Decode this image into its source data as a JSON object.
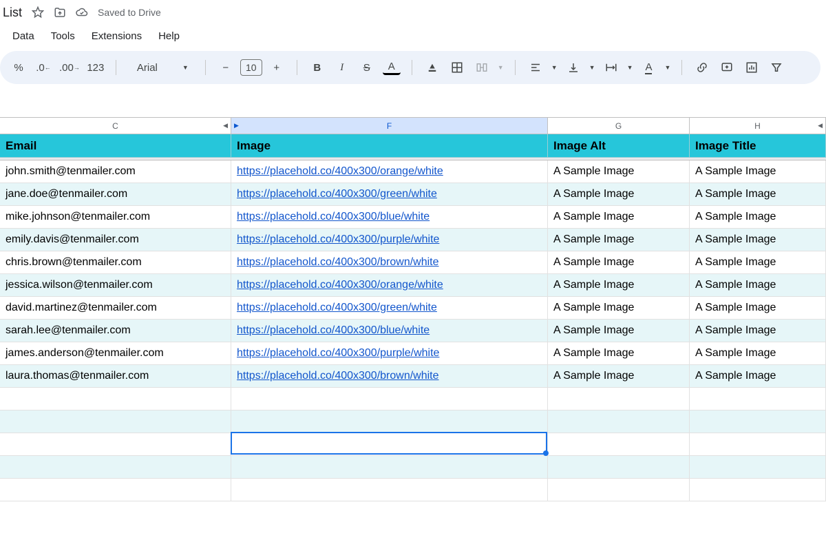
{
  "title": "List",
  "saved": "Saved to Drive",
  "menu": {
    "data": "Data",
    "tools": "Tools",
    "extensions": "Extensions",
    "help": "Help"
  },
  "toolbar": {
    "pct": "%",
    "dec_dec": ".0",
    "dec_inc": ".00",
    "fmt123": "123",
    "font": "Arial",
    "minus": "−",
    "size": "10",
    "plus": "+",
    "bold": "B",
    "italic": "I",
    "strike": "S",
    "textcolor": "A",
    "link": "⌘",
    "filter": "▿"
  },
  "cols": {
    "C": "C",
    "F": "F",
    "G": "G",
    "H": "H"
  },
  "headers": {
    "email": "Email",
    "image": "Image",
    "alt": "Image Alt",
    "title": "Image Title"
  },
  "rows": [
    {
      "email": "john.smith@tenmailer.com",
      "image": "https://placehold.co/400x300/orange/white",
      "alt": "A Sample Image",
      "title": "A Sample Image"
    },
    {
      "email": "jane.doe@tenmailer.com",
      "image": "https://placehold.co/400x300/green/white",
      "alt": "A Sample Image",
      "title": "A Sample Image"
    },
    {
      "email": "mike.johnson@tenmailer.com",
      "image": "https://placehold.co/400x300/blue/white",
      "alt": "A Sample Image",
      "title": "A Sample Image"
    },
    {
      "email": "emily.davis@tenmailer.com",
      "image": "https://placehold.co/400x300/purple/white",
      "alt": "A Sample Image",
      "title": "A Sample Image"
    },
    {
      "email": "chris.brown@tenmailer.com",
      "image": "https://placehold.co/400x300/brown/white",
      "alt": "A Sample Image",
      "title": "A Sample Image"
    },
    {
      "email": "jessica.wilson@tenmailer.com",
      "image": "https://placehold.co/400x300/orange/white",
      "alt": "A Sample Image",
      "title": "A Sample Image"
    },
    {
      "email": "david.martinez@tenmailer.com",
      "image": "https://placehold.co/400x300/green/white",
      "alt": "A Sample Image",
      "title": "A Sample Image"
    },
    {
      "email": "sarah.lee@tenmailer.com",
      "image": "https://placehold.co/400x300/blue/white",
      "alt": "A Sample Image",
      "title": "A Sample Image"
    },
    {
      "email": "james.anderson@tenmailer.com",
      "image": "https://placehold.co/400x300/purple/white",
      "alt": "A Sample Image",
      "title": "A Sample Image"
    },
    {
      "email": "laura.thomas@tenmailer.com",
      "image": "https://placehold.co/400x300/brown/white",
      "alt": "A Sample Image",
      "title": "A Sample Image"
    }
  ],
  "selection": {
    "col": "F",
    "rowIndex": 13
  }
}
